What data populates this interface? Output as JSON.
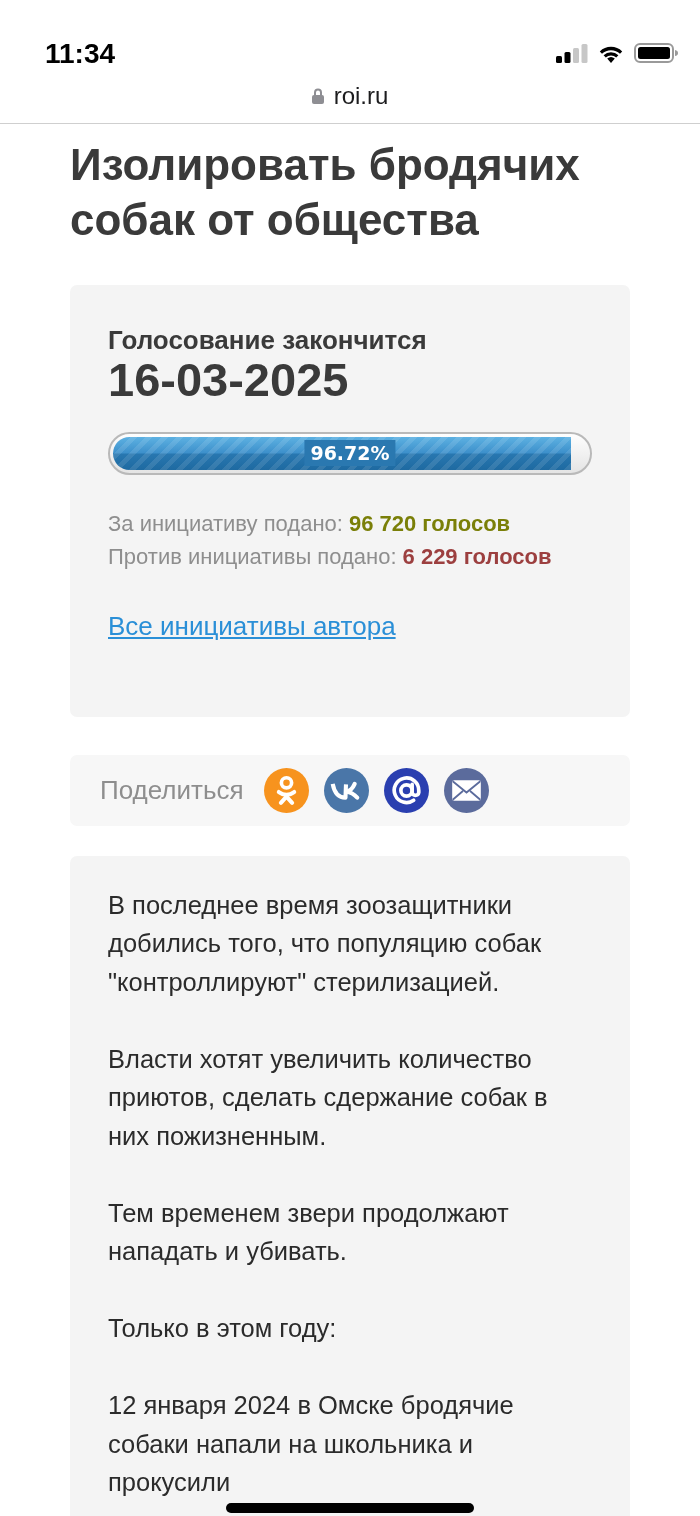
{
  "status_bar": {
    "time": "11:34"
  },
  "address_bar": {
    "url": "roi.ru"
  },
  "title": "Изолировать бродячих собак от общества",
  "voting": {
    "ends_label": "Голосование закончится",
    "end_date": "16-03-2025",
    "progress": {
      "level": 0.9672,
      "label": "96.72%"
    },
    "votes": [
      {
        "label": "За инициативу подано:",
        "count": "96 720 голосов",
        "color": "#7a7f08"
      },
      {
        "label": "Против инициативы подано:",
        "count": "6 229 голосов",
        "color": "#9c3f3f"
      }
    ],
    "author_link": "Все инициативы автора"
  },
  "share": {
    "label": "Поделиться",
    "buttons": [
      {
        "kind": "ok",
        "color": "#f7931e"
      },
      {
        "kind": "vk",
        "color": "#4a76a8"
      },
      {
        "kind": "at",
        "color": "#2a3fb0"
      },
      {
        "kind": "email",
        "color": "#5b6b9c"
      }
    ]
  },
  "description": {
    "paragraphs": [
      "В последнее время зоозащитники добились того, что популяцию собак \"контроллируют\" стерилизацией.",
      "Власти хотят увеличить количество приютов, сделать сдержание собак в них пожизненным.",
      "Тем временем звери продолжают нападать и убивать.",
      "Только в этом году:",
      "12 января 2024 в Омске бродячие собаки напали на школьника и прокусили"
    ]
  }
}
